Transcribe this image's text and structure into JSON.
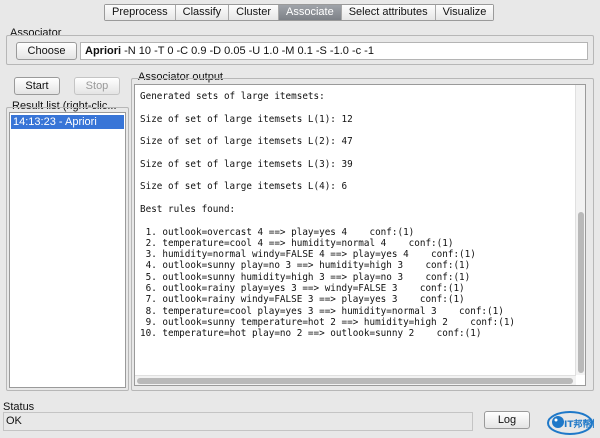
{
  "tabs": [
    {
      "label": "Preprocess",
      "active": false
    },
    {
      "label": "Classify",
      "active": false
    },
    {
      "label": "Cluster",
      "active": false
    },
    {
      "label": "Associate",
      "active": true
    },
    {
      "label": "Select attributes",
      "active": false
    },
    {
      "label": "Visualize",
      "active": false
    }
  ],
  "associator": {
    "section_title": "Associator",
    "choose_label": "Choose",
    "algorithm_name": "Apriori",
    "options": "-N 10 -T 0 -C 0.9 -D 0.05 -U 1.0 -M 0.1 -S -1.0 -c -1"
  },
  "controls": {
    "start_label": "Start",
    "stop_label": "Stop"
  },
  "result_list": {
    "title": "Result list (right-clic...",
    "items": [
      "14:13:23 - Apriori"
    ]
  },
  "output": {
    "title": "Associator output",
    "lines": [
      "Generated sets of large itemsets:",
      "",
      "Size of set of large itemsets L(1): 12",
      "",
      "Size of set of large itemsets L(2): 47",
      "",
      "Size of set of large itemsets L(3): 39",
      "",
      "Size of set of large itemsets L(4): 6",
      "",
      "Best rules found:",
      "",
      " 1. outlook=overcast 4 ==> play=yes 4    conf:(1)",
      " 2. temperature=cool 4 ==> humidity=normal 4    conf:(1)",
      " 3. humidity=normal windy=FALSE 4 ==> play=yes 4    conf:(1)",
      " 4. outlook=sunny play=no 3 ==> humidity=high 3    conf:(1)",
      " 5. outlook=sunny humidity=high 3 ==> play=no 3    conf:(1)",
      " 6. outlook=rainy play=yes 3 ==> windy=FALSE 3    conf:(1)",
      " 7. outlook=rainy windy=FALSE 3 ==> play=yes 3    conf:(1)",
      " 8. temperature=cool play=yes 3 ==> humidity=normal 3    conf:(1)",
      " 9. outlook=sunny temperature=hot 2 ==> humidity=high 2    conf:(1)",
      "10. temperature=hot play=no 2 ==> outlook=sunny 2    conf:(1)"
    ]
  },
  "status": {
    "title": "Status",
    "text": "OK",
    "log_label": "Log"
  },
  "logo": {
    "text": "IT邦帮忙"
  },
  "colors": {
    "selection": "#3875d7",
    "active_tab": "#8a8e94",
    "logo_blue": "#1e78c8"
  }
}
